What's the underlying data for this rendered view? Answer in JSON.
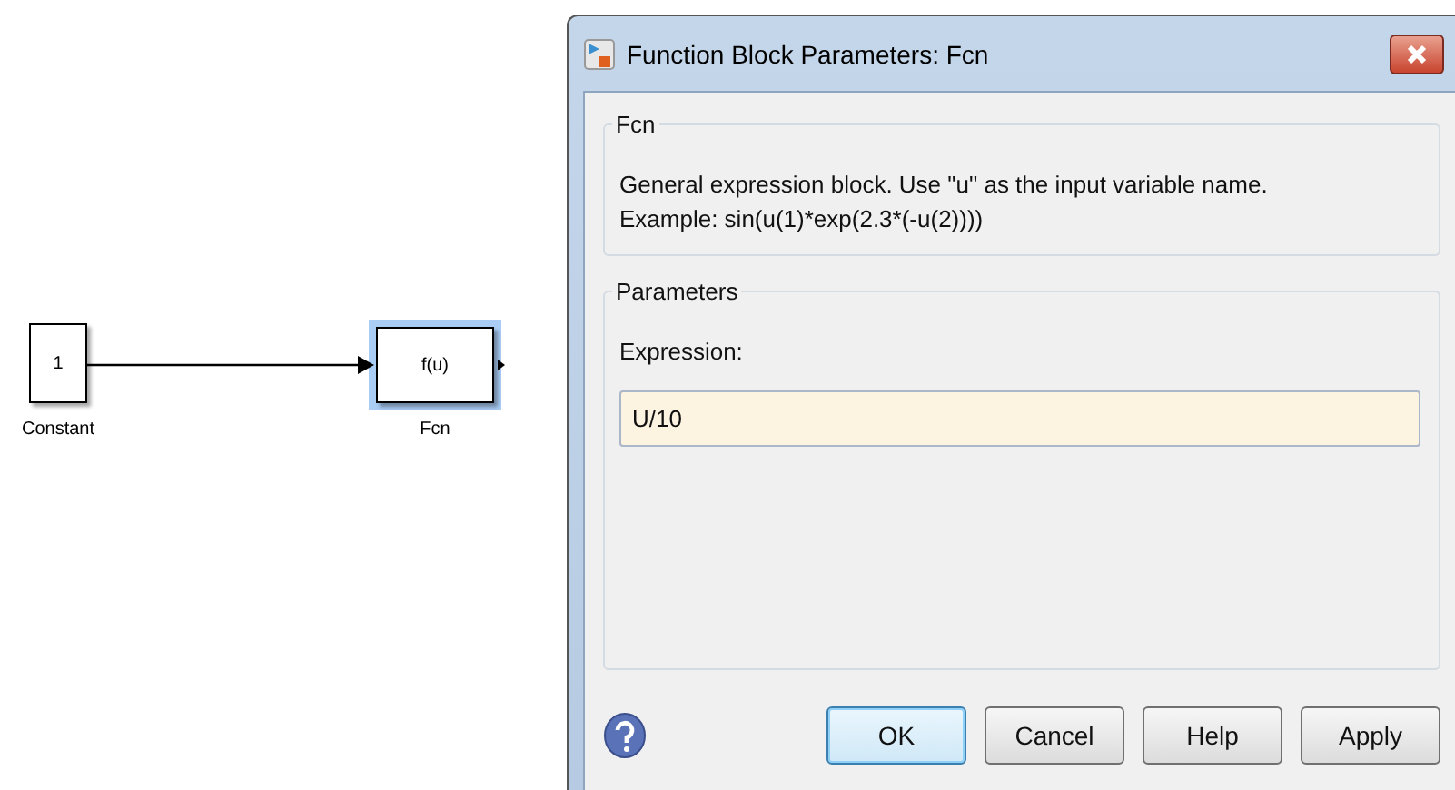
{
  "diagram": {
    "blocks": [
      {
        "text": "1",
        "label": "Constant",
        "selected": false
      },
      {
        "text": "f(u)",
        "label": "Fcn",
        "selected": true
      }
    ]
  },
  "dialog": {
    "title": "Function Block Parameters: Fcn",
    "description_group": {
      "title": "Fcn",
      "lines": [
        "General expression block. Use \"u\" as the input variable name.",
        "Example: sin(u(1)*exp(2.3*(-u(2))))"
      ]
    },
    "parameters_group": {
      "title": "Parameters",
      "field_label": "Expression:",
      "value": "U/10"
    },
    "buttons": [
      {
        "label": "OK",
        "default": true
      },
      {
        "label": "Cancel",
        "default": false
      },
      {
        "label": "Help",
        "default": false
      },
      {
        "label": "Apply",
        "default": false
      }
    ]
  }
}
